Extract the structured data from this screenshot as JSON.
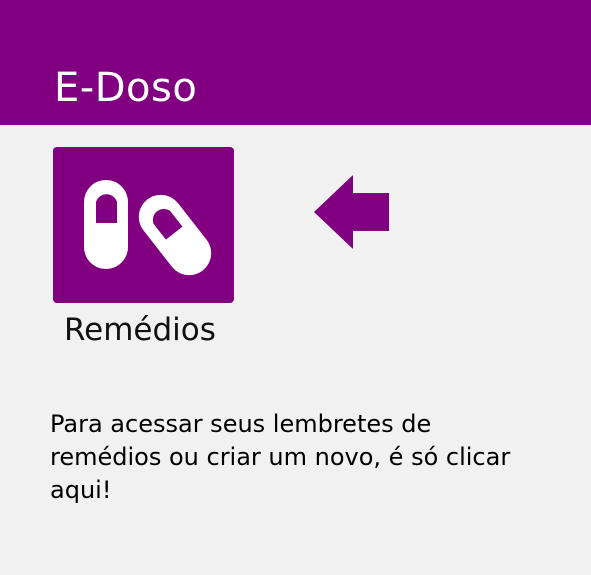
{
  "app": {
    "title": "E-Doso"
  },
  "tile": {
    "label": "Remédios",
    "icon": "pills-icon"
  },
  "pointer": {
    "icon": "arrow-left-icon"
  },
  "hint": {
    "text": "Para acessar seus lembretes de remédios ou criar um novo, é só clicar aqui!"
  },
  "colors": {
    "primary": "#800080",
    "background": "#f1f1f1",
    "icon": "#ffffff"
  }
}
